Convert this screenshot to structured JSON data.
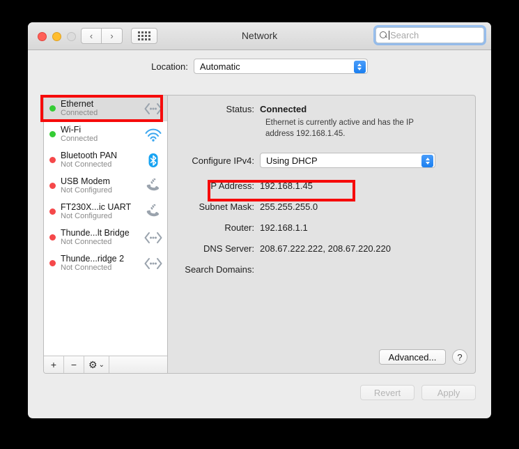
{
  "window": {
    "title": "Network",
    "traffic_lights": [
      "close",
      "minimize",
      "zoom"
    ],
    "nav_back": "‹",
    "nav_forward": "›",
    "grid_button": "show-all"
  },
  "search": {
    "placeholder": "Search",
    "value": "",
    "icon": "search-icon"
  },
  "location": {
    "label": "Location:",
    "value": "Automatic"
  },
  "sidebar": {
    "services": [
      {
        "name": "Ethernet",
        "state": "Connected",
        "dot": "green",
        "icon": "ethernet-icon"
      },
      {
        "name": "Wi-Fi",
        "state": "Connected",
        "dot": "green",
        "icon": "wifi-icon"
      },
      {
        "name": "Bluetooth PAN",
        "state": "Not Connected",
        "dot": "red",
        "icon": "bluetooth-icon"
      },
      {
        "name": "USB Modem",
        "state": "Not Configured",
        "dot": "red",
        "icon": "modem-icon"
      },
      {
        "name": "FT230X...ic UART",
        "state": "Not Configured",
        "dot": "red",
        "icon": "modem-icon"
      },
      {
        "name": "Thunde...lt Bridge",
        "state": "Not Connected",
        "dot": "red",
        "icon": "ethernet-icon"
      },
      {
        "name": "Thunde...ridge 2",
        "state": "Not Connected",
        "dot": "red",
        "icon": "ethernet-icon"
      }
    ],
    "selected_index": 0,
    "toolbar": {
      "add": "+",
      "remove": "−",
      "actions": "⚙",
      "actions_chevron": "⌄"
    }
  },
  "detail": {
    "status_label": "Status:",
    "status_value": "Connected",
    "status_description": "Ethernet is currently active and has the IP address 192.168.1.45.",
    "configure_label": "Configure IPv4:",
    "configure_value": "Using DHCP",
    "fields": [
      {
        "label": "IP Address:",
        "value": "192.168.1.45"
      },
      {
        "label": "Subnet Mask:",
        "value": "255.255.255.0"
      },
      {
        "label": "Router:",
        "value": "192.168.1.1"
      },
      {
        "label": "DNS Server:",
        "value": "208.67.222.222, 208.67.220.220"
      },
      {
        "label": "Search Domains:",
        "value": ""
      }
    ],
    "advanced_label": "Advanced...",
    "help_label": "?"
  },
  "footer": {
    "revert_label": "Revert",
    "apply_label": "Apply"
  },
  "annotations": {
    "color": "#f60b0b",
    "targets": [
      "ethernet-service-row",
      "ip-address-field"
    ]
  }
}
